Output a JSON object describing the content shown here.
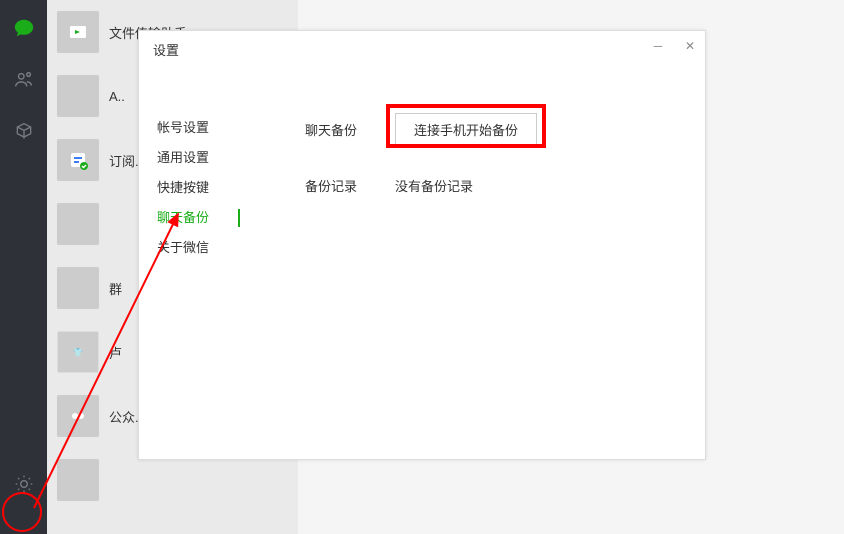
{
  "nav": {
    "chat_icon": "chat-bubble",
    "contacts_icon": "contacts",
    "favorites_icon": "cube",
    "settings_icon": "gear"
  },
  "chats": [
    {
      "name": "文件传输助手",
      "avatar": "green-arrow"
    },
    {
      "name": "A..",
      "avatar": "pix"
    },
    {
      "name": "订阅..",
      "avatar": "blue"
    },
    {
      "name": "",
      "avatar": "pix"
    },
    {
      "name": "群",
      "avatar": "pix"
    },
    {
      "name": "卢",
      "avatar": "white"
    },
    {
      "name": "公众..",
      "avatar": "green"
    },
    {
      "name": "",
      "avatar": "pix"
    }
  ],
  "settings": {
    "title": "设置",
    "nav": [
      {
        "label": "帐号设置",
        "active": false
      },
      {
        "label": "通用设置",
        "active": false
      },
      {
        "label": "快捷按键",
        "active": false
      },
      {
        "label": "聊天备份",
        "active": true
      },
      {
        "label": "关于微信",
        "active": false
      }
    ],
    "backup": {
      "row1_label": "聊天备份",
      "row1_button": "连接手机开始备份",
      "row2_label": "备份记录",
      "row2_value": "没有备份记录"
    }
  },
  "colors": {
    "accent": "#1aad19",
    "highlight": "#ff0000"
  }
}
